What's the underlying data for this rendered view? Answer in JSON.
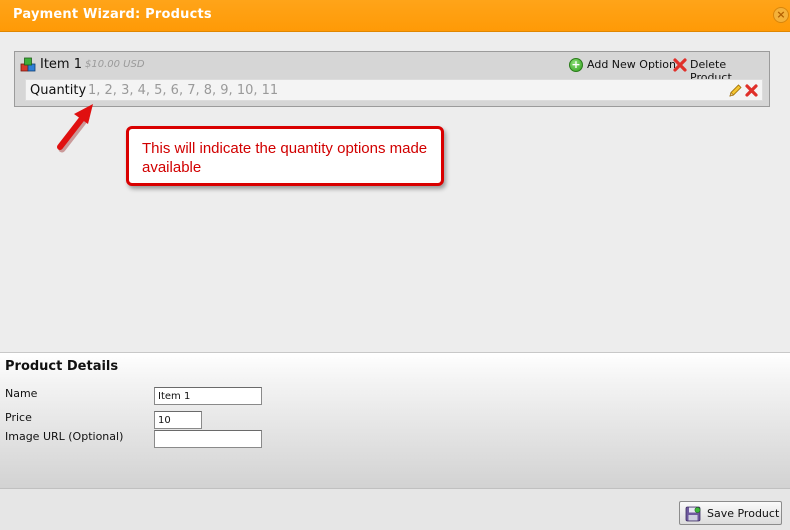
{
  "window": {
    "title": "Payment Wizard: Products",
    "close_icon": "close-icon"
  },
  "product": {
    "name": "Item 1",
    "price": "$10.00 USD",
    "add_option_label": "Add New Option",
    "delete_product_label": "Delete Product",
    "option": {
      "label": "Quantity",
      "values": "1, 2, 3, 4, 5, 6, 7, 8, 9, 10, 11"
    }
  },
  "annotation": {
    "text": "This will indicate the quantity options made available",
    "color": "#d90000"
  },
  "details": {
    "title": "Product Details",
    "fields": [
      {
        "label": "Name",
        "value": "Item 1",
        "placeholder": ""
      },
      {
        "label": "Price",
        "value": "10",
        "placeholder": ""
      },
      {
        "label": "Image URL (Optional)",
        "value": "",
        "placeholder": ""
      }
    ]
  },
  "footer": {
    "save_label": "Save Product"
  },
  "colors": {
    "titlebar": "#ff9f0f",
    "accent_red": "#d90000",
    "add_green": "#2e9f1a"
  }
}
